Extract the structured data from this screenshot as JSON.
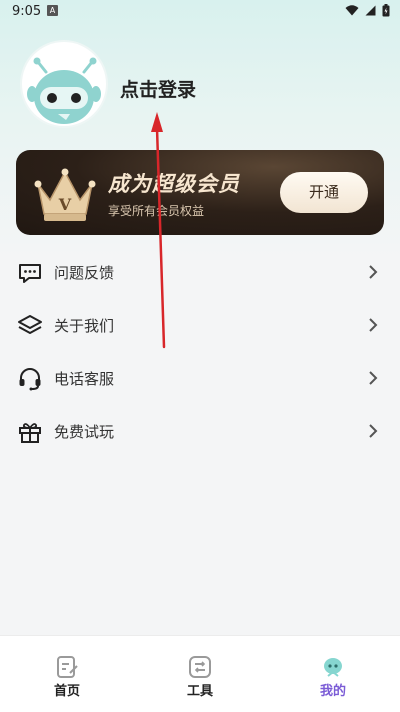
{
  "status_bar": {
    "time": "9:05",
    "notification_badge": "A",
    "icons": [
      "wifi-icon",
      "signal-icon",
      "battery-icon"
    ]
  },
  "profile": {
    "login_text": "点击登录"
  },
  "vip": {
    "title": "成为超级会员",
    "subtitle": "享受所有会员权益",
    "button_label": "开通",
    "crown_letter": "V",
    "accent": "#f7e6cf"
  },
  "menu": {
    "items": [
      {
        "label": "问题反馈",
        "icon": "feedback-icon"
      },
      {
        "label": "关于我们",
        "icon": "layers-icon"
      },
      {
        "label": "电话客服",
        "icon": "headset-icon"
      },
      {
        "label": "免费试玩",
        "icon": "gift-icon"
      }
    ]
  },
  "bottom_nav": {
    "items": [
      {
        "label": "首页",
        "icon": "home-doc-icon"
      },
      {
        "label": "工具",
        "icon": "tools-icon"
      },
      {
        "label": "我的",
        "icon": "mine-icon"
      }
    ],
    "active_index": 2,
    "active_color": "#7b5cd6"
  },
  "annotation": {
    "arrow_color": "#d8262a"
  }
}
